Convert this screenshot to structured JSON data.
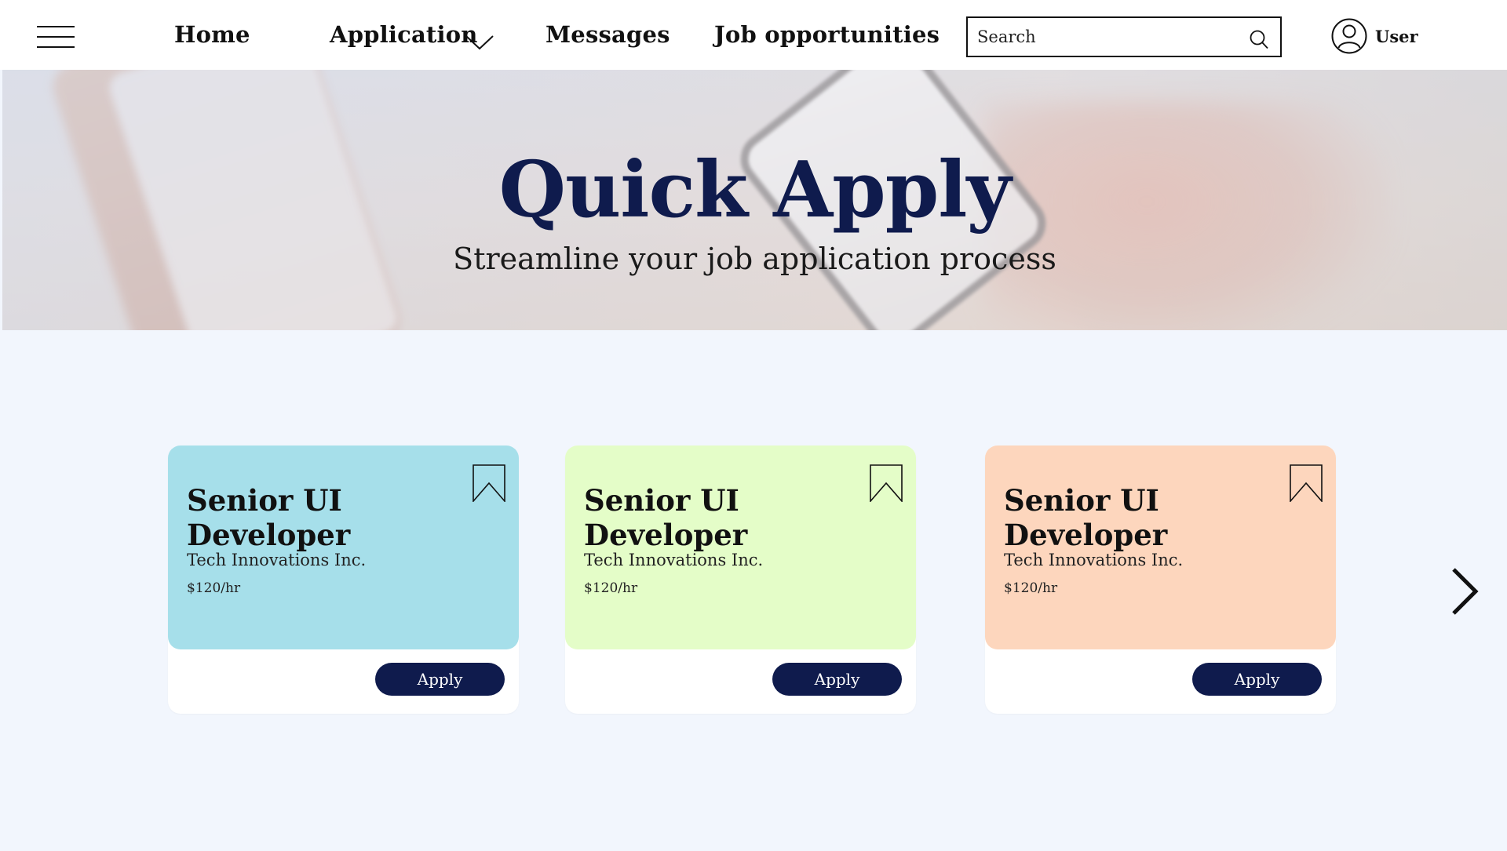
{
  "nav": {
    "items": [
      {
        "label": "Home"
      },
      {
        "label": "Application"
      },
      {
        "label": "Messages"
      },
      {
        "label": "Job opportunities"
      }
    ],
    "search_placeholder": "Search",
    "user_label": "User"
  },
  "hero": {
    "title": "Quick Apply",
    "subtitle": "Streamline your job application process"
  },
  "jobs": [
    {
      "title": "Senior UI Developer",
      "company": "Tech Innovations Inc.",
      "rate": "$120/hr",
      "apply_label": "Apply",
      "color": "#a6dfea"
    },
    {
      "title": "Senior UI Developer",
      "company": "Tech Innovations Inc.",
      "rate": "$120/hr",
      "apply_label": "Apply",
      "color": "#e4fdc8"
    },
    {
      "title": "Senior UI Developer",
      "company": "Tech Innovations Inc.",
      "rate": "$120/hr",
      "apply_label": "Apply",
      "color": "#fdd6bd"
    }
  ],
  "colors": {
    "accent": "#0f1b4d",
    "page_background": "#f2f6fd"
  },
  "icons": {
    "menu": "hamburger-menu-icon",
    "dropdown": "chevron-down-icon",
    "search": "search-icon",
    "user": "user-avatar-icon",
    "bookmark": "bookmark-icon",
    "next": "chevron-right-icon"
  }
}
